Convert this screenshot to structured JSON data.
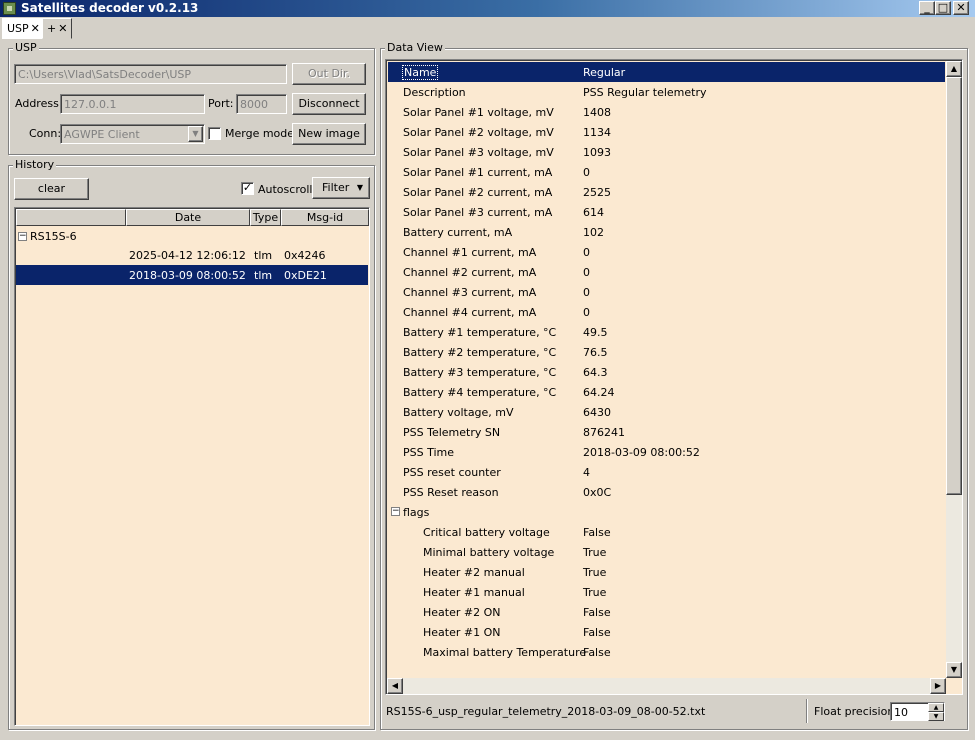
{
  "window": {
    "title": "Satellites decoder v0.2.13",
    "icon": "app-icon",
    "controls": {
      "minimize": "_",
      "maximize": "□",
      "close": "✕"
    }
  },
  "tabs": [
    {
      "label": "USP",
      "close": "✕",
      "active": true
    },
    {
      "label": "+",
      "close": "✕",
      "active": false
    }
  ],
  "usp": {
    "group_label": "USP",
    "path": "C:\\Users\\Vlad\\SatsDecoder\\USP",
    "out_dir_label": "Out Dir.",
    "address_label": "Address:",
    "address": "127.0.0.1",
    "port_label": "Port:",
    "port": "8000",
    "disconnect_label": "Disconnect",
    "conn_label": "Conn:",
    "conn_value": "AGWPE Client",
    "merge_label": "Merge mode",
    "merge_checked": false,
    "new_image_label": "New image"
  },
  "history": {
    "group_label": "History",
    "clear_label": "clear",
    "autoscroll_label": "Autoscroll",
    "autoscroll_checked": true,
    "filter_label": "Filter",
    "columns": [
      "",
      "Date",
      "Type",
      "Msg-id"
    ],
    "root": {
      "label": "RS15S-6",
      "expander": "−"
    },
    "rows": [
      {
        "date": "2025-04-12 12:06:12",
        "type": "tlm",
        "msg_id": "0x4246",
        "selected": false
      },
      {
        "date": "2018-03-09 08:00:52",
        "type": "tlm",
        "msg_id": "0xDE21",
        "selected": true
      }
    ]
  },
  "data_view": {
    "group_label": "Data View",
    "rows": [
      {
        "key": "Name",
        "value": "Regular"
      },
      {
        "key": "Description",
        "value": "PSS Regular telemetry"
      },
      {
        "key": "Solar Panel #1 voltage, mV",
        "value": "1408"
      },
      {
        "key": "Solar Panel #2 voltage, mV",
        "value": "1134"
      },
      {
        "key": "Solar Panel #3 voltage, mV",
        "value": "1093"
      },
      {
        "key": "Solar Panel #1 current, mA",
        "value": "0"
      },
      {
        "key": "Solar Panel #2 current, mA",
        "value": "2525"
      },
      {
        "key": "Solar Panel #3 current, mA",
        "value": "614"
      },
      {
        "key": "Battery current, mA",
        "value": "102"
      },
      {
        "key": "Channel #1 current, mA",
        "value": "0"
      },
      {
        "key": "Channel #2 current, mA",
        "value": "0"
      },
      {
        "key": "Channel #3 current, mA",
        "value": "0"
      },
      {
        "key": "Channel #4 current, mA",
        "value": "0"
      },
      {
        "key": "Battery #1 temperature, °C",
        "value": "49.5"
      },
      {
        "key": "Battery #2 temperature, °C",
        "value": "76.5"
      },
      {
        "key": "Battery #3 temperature, °C",
        "value": "64.3"
      },
      {
        "key": "Battery #4 temperature, °C",
        "value": "64.24"
      },
      {
        "key": "Battery voltage, mV",
        "value": "6430"
      },
      {
        "key": "PSS Telemetry SN",
        "value": "876241"
      },
      {
        "key": "PSS Time",
        "value": "2018-03-09 08:00:52"
      },
      {
        "key": "PSS reset counter",
        "value": "4"
      },
      {
        "key": "PSS Reset reason",
        "value": "0x0C"
      },
      {
        "key": "flags",
        "value": "",
        "expander": "−"
      },
      {
        "key": "Critical battery voltage",
        "value": "False",
        "child": true
      },
      {
        "key": "Minimal battery voltage",
        "value": "True",
        "child": true
      },
      {
        "key": "Heater #2 manual",
        "value": "True",
        "child": true
      },
      {
        "key": "Heater #1 manual",
        "value": "True",
        "child": true
      },
      {
        "key": "Heater #2 ON",
        "value": "False",
        "child": true
      },
      {
        "key": "Heater #1 ON",
        "value": "False",
        "child": true
      },
      {
        "key": "Maximal battery Temperature",
        "value": "False",
        "child": true
      }
    ]
  },
  "status": {
    "filename": "RS15S-6_usp_regular_telemetry_2018-03-09_08-00-52.txt",
    "float_precision_label": "Float precision:",
    "float_precision": "10"
  },
  "colors": {
    "panel_bg": "#fbe9d1",
    "selection": "#0a246a",
    "window_bg": "#d4d0c8"
  }
}
